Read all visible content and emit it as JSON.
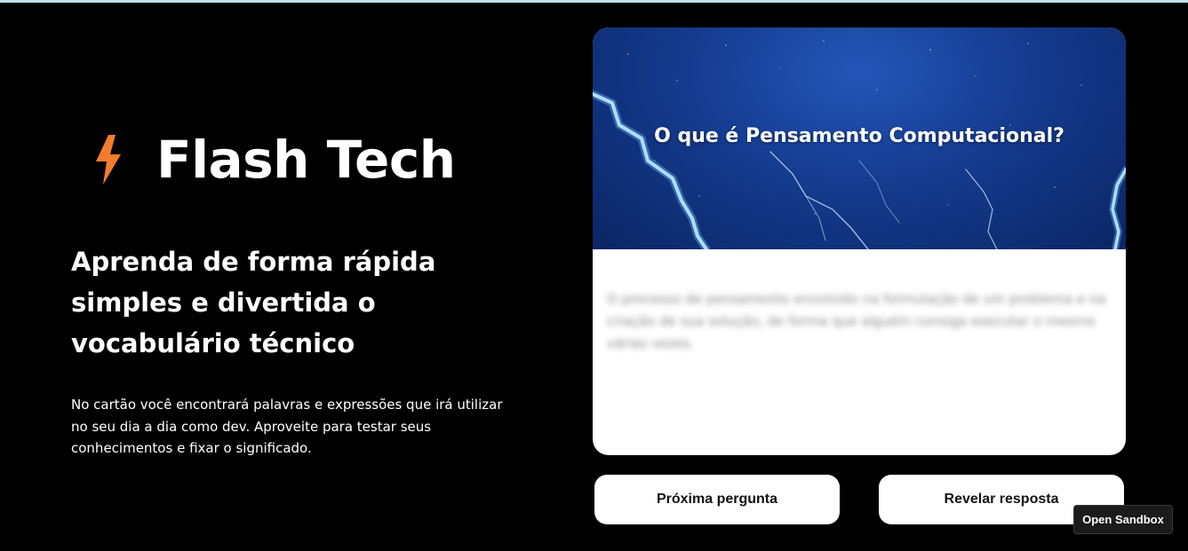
{
  "brand": {
    "name": "Flash Tech",
    "icon": "lightning-bolt-icon",
    "accent_color": "#f47c2c"
  },
  "hero": {
    "headline": "Aprenda de forma rápida simples e divertida o vocabulário técnico",
    "description": "No cartão você encontrará palavras e expressões que irá utilizar no seu dia a dia como dev. Aproveite para testar seus conhecimentos e fixar o significado."
  },
  "card": {
    "question": "O que é Pensamento Computacional?",
    "answer": "O processo de pensamento envolvido na formulação de um problema e na criação de sua solução, de forma que alguém consiga executar o mesmo várias vezes.",
    "answer_hidden": true
  },
  "buttons": {
    "next_label": "Próxima pergunta",
    "reveal_label": "Revelar resposta"
  },
  "sandbox": {
    "label": "Open Sandbox"
  }
}
